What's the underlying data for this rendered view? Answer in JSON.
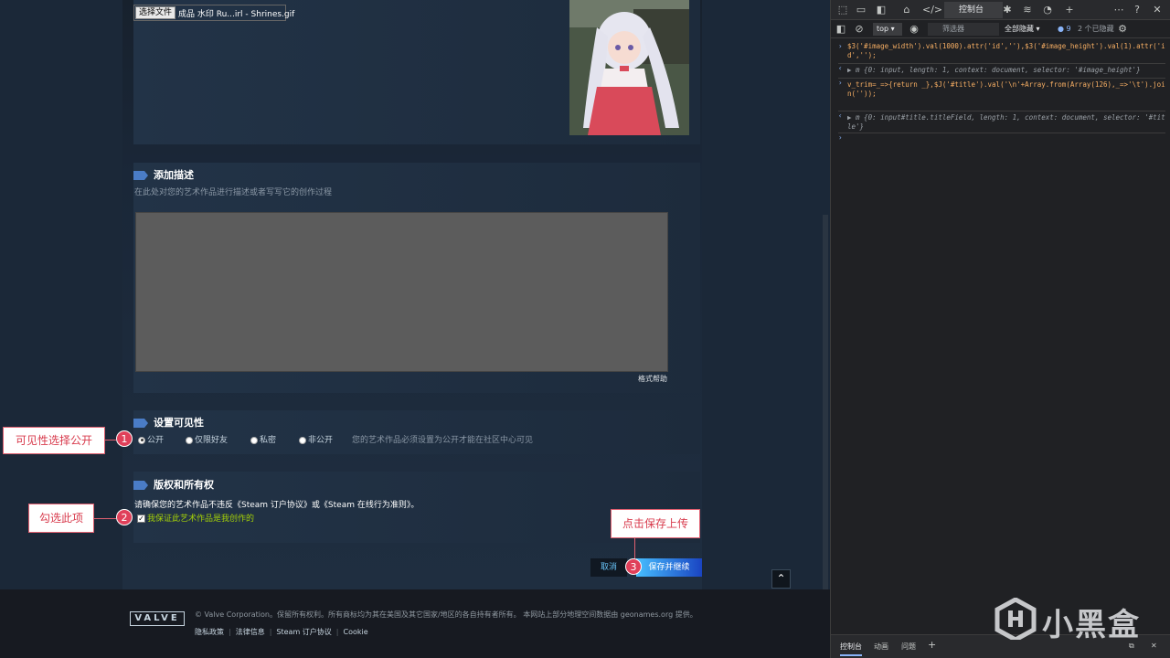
{
  "upload": {
    "file_button": "选择文件",
    "file_name": "成品 水印 Ru...irl - Shrines.gif"
  },
  "description": {
    "heading": "添加描述",
    "hint": "在此处对您的艺术作品进行描述或者写写它的创作过程",
    "value": "",
    "format_help": "格式帮助"
  },
  "visibility": {
    "heading": "设置可见性",
    "options": [
      "公开",
      "仅限好友",
      "私密",
      "非公开"
    ],
    "selected": "公开",
    "note": "您的艺术作品必须设置为公开才能在社区中心可见"
  },
  "copyright": {
    "heading": "版权和所有权",
    "text": "请确保您的艺术作品不违反《Steam 订户协议》或《Steam 在线行为准则》。",
    "checkbox_label": "我保证此艺术作品是我创作的",
    "checked": true
  },
  "actions": {
    "cancel": "取消",
    "save": "保存并继续",
    "scroll_top": "⌃"
  },
  "footer": {
    "logo": "VALVE",
    "copyright": "© Valve Corporation。保留所有权利。所有商标均为其在美国及其它国家/地区的各自持有者所有。 本网站上部分地理空间数据由 geonames.org 提供。",
    "links": [
      "隐私政策",
      "法律信息",
      "Steam 订户协议",
      "Cookie"
    ]
  },
  "annotations": {
    "a1": {
      "num": "1",
      "label": "可见性选择公开"
    },
    "a2": {
      "num": "2",
      "label": "勾选此项"
    },
    "a3": {
      "num": "3",
      "label": "点击保存上传"
    }
  },
  "devtools": {
    "active_tab": "控制台",
    "context": "top",
    "filter_placeholder": "筛选器",
    "levels": "全部隐藏",
    "issues_count": "9",
    "hidden_count": "2 个已隐藏",
    "drawer_tabs": [
      "控制台",
      "动画",
      "问题"
    ],
    "console": {
      "cmd1": "$3('#image_width').val(1000).attr('id',''),$3('#image_height').val(1).attr('id','');",
      "res1": "▶ m {0: input, length: 1, context: document, selector: '#image_height'}",
      "cmd2": "v_trim=_=>{return _},$J('#title').val('\\n'+Array.from(Array(126),_=>'\\t').join(''));",
      "res2": "▶ m {0: input#title.titleField, length: 1, context: document, selector: '#title'}"
    }
  },
  "watermark": "小黑盒",
  "colors": {
    "accent_blue": "#4a7cc6",
    "link_blue": "#67c1f5",
    "check_green": "#a4d007",
    "annotation_red": "#e0405a"
  }
}
